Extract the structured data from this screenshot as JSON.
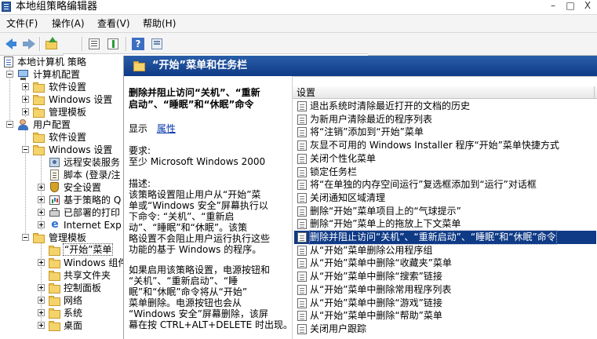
{
  "window": {
    "title": "本地组策略编辑器",
    "min_label": "–",
    "max_label": "□",
    "close_label": "X"
  },
  "menubar": [
    {
      "label": "文件(F)"
    },
    {
      "label": "操作(A)"
    },
    {
      "label": "查看(V)"
    },
    {
      "label": "帮助(H)"
    }
  ],
  "toolbar": {
    "icons": [
      "back-icon",
      "forward-icon",
      "up-folder-icon",
      "show-hide-tree-icon",
      "export-list-icon",
      "properties-icon",
      "help-icon",
      "console-icon"
    ]
  },
  "tree": {
    "root": "本地计算机 策略",
    "computer_config": "计算机配置",
    "cc_software": "软件设置",
    "cc_windows": "Windows 设置",
    "cc_admin": "管理模板",
    "user_config": "用户配置",
    "uc_software": "软件设置",
    "uc_windows": "Windows 设置",
    "uc_install": "远程安装服务",
    "uc_scripts": "脚本 (登录/注",
    "uc_security": "安全设置",
    "uc_qos": "基于策略的 Q",
    "uc_printers": "已部署的打印",
    "uc_ie": "Internet Exp",
    "uc_admin": "管理模板",
    "uc_startmenu": "“开始”菜单",
    "uc_wincomp": "Windows 组件",
    "uc_shared": "共享文件夹",
    "uc_control": "控制面板",
    "uc_network": "网络",
    "uc_system": "系统",
    "uc_desktop": "桌面"
  },
  "header": {
    "title": "“开始”菜单和任务栏"
  },
  "description": {
    "title_line1": "删除并阻止访问“关机”、“重新",
    "title_line2": "启动”、“睡眠”和“休眠”命令",
    "show": "显示",
    "properties_link": "属性",
    "req_label": "要求:",
    "req_value": "至少 Microsoft Windows 2000",
    "desc_label": "描述:",
    "p1": [
      "该策略设置阻止用户从“开始”菜",
      "单或“Windows 安全”屏幕执行以",
      "下命令: “关机”、“重新启",
      "动”、“睡眠”和“休眠”。该策",
      "略设置不会阻止用户运行执行这些",
      "功能的基于 Windows 的程序。"
    ],
    "p2": [
      "如果启用该策略设置，电源按钮和",
      "“关机”、“重新启动”、“睡",
      "眠”和“休眠”命令将从“开始”",
      "菜单删除。电源按钮也会从",
      "“Windows 安全”屏幕删除，该屏",
      "幕在按 CTRL+ALT+DELETE 时出现。"
    ]
  },
  "list": {
    "column_header": "设置",
    "items": [
      "退出系统时清除最近打开的文档的历史",
      "为新用户清除最近的程序列表",
      "将“注销”添加到“开始”菜单",
      "灰显不可用的 Windows Installer 程序“开始”菜单快捷方式",
      "关闭个性化菜单",
      "锁定任务栏",
      "将“在单独的内存空间运行”复选框添加到“运行”对话框",
      "关闭通知区域清理",
      "删除“开始”菜单项目上的“气球提示”",
      "删除“开始”菜单上的拖放上下文菜单",
      "删除并阻止访问“关机”、“重新启动”、“睡眠”和“休眠”命令",
      "从“开始”菜单删除公用程序组",
      "从“开始”菜单中删除“收藏夹”菜单",
      "从“开始”菜单中删除“搜索”链接",
      "从“开始”菜单中删除常用程序列表",
      "从“开始”菜单中删除“游戏”链接",
      "从“开始”菜单中删除“帮助”菜单",
      "关闭用户跟踪"
    ],
    "selected_index": 10
  },
  "colors": {
    "accent": "#0f3a86",
    "header_bg": "#1f4f9e",
    "link": "#0033aa"
  }
}
